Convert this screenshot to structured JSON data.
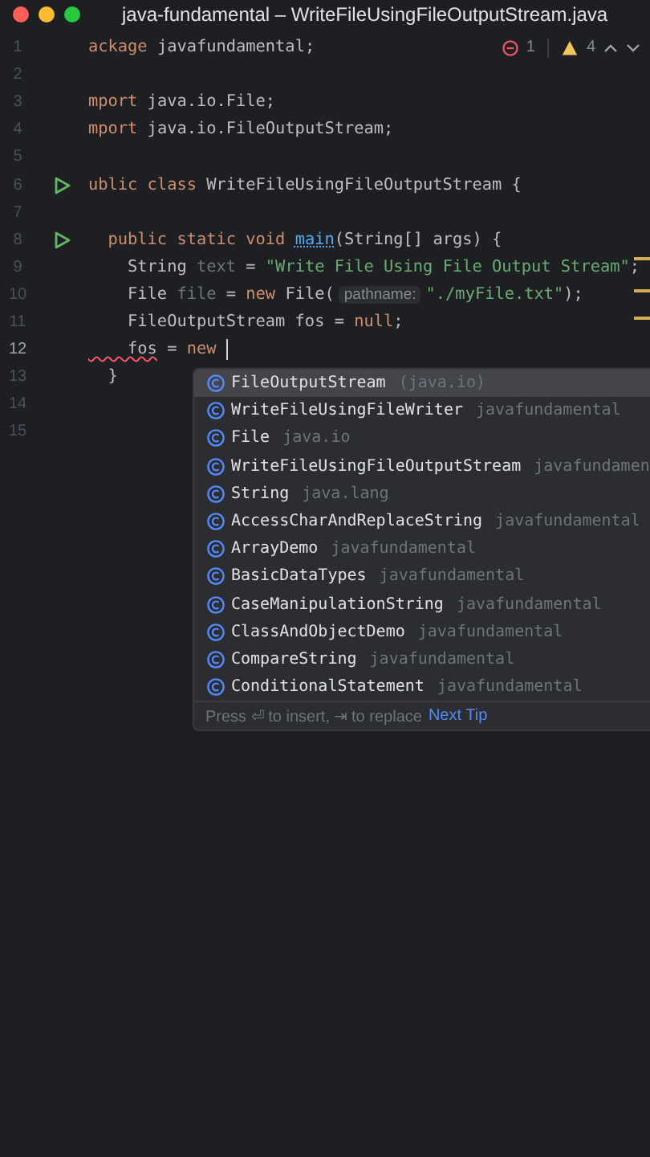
{
  "window": {
    "title": "java-fundamental – WriteFileUsingFileOutputStream.java"
  },
  "inspections": {
    "errors": "1",
    "warnings": "4"
  },
  "lines": [
    {
      "number": "1",
      "run": false,
      "current": false,
      "tokens": [
        {
          "text": "ackage",
          "kind": "keyword"
        },
        {
          "text": " javafundamental;",
          "kind": "plain"
        }
      ]
    },
    {
      "number": "2",
      "run": false,
      "current": false
    },
    {
      "number": "3",
      "run": false,
      "current": false,
      "tokens": [
        {
          "text": "mport",
          "kind": "keyword"
        },
        {
          "text": " java.io.File;",
          "kind": "plain"
        }
      ]
    },
    {
      "number": "4",
      "run": false,
      "current": false,
      "tokens": [
        {
          "text": "mport",
          "kind": "keyword"
        },
        {
          "text": " java.io.FileOutputStream;",
          "kind": "plain"
        }
      ]
    },
    {
      "number": "5",
      "run": false,
      "current": false
    },
    {
      "number": "6",
      "run": true,
      "current": false,
      "tokens": [
        {
          "text": "ublic class",
          "kind": "keyword"
        },
        {
          "text": " WriteFileUsingFileOutputStream {",
          "kind": "plain"
        }
      ]
    },
    {
      "number": "7",
      "run": false,
      "current": false
    },
    {
      "number": "8",
      "run": true,
      "current": false,
      "tokens": [
        {
          "text": "  public static void ",
          "kind": "keyword"
        },
        {
          "text": "main",
          "kind": "method"
        },
        {
          "text": "(String[] args) {",
          "kind": "plain"
        }
      ]
    },
    {
      "number": "9",
      "run": false,
      "current": false,
      "tokens": [
        {
          "text": "    String ",
          "kind": "plain"
        },
        {
          "text": "text",
          "kind": "unused"
        },
        {
          "text": " = ",
          "kind": "plain"
        },
        {
          "text": "\"Write File Using File Output Stream\"",
          "kind": "string"
        },
        {
          "text": ";",
          "kind": "plain"
        }
      ]
    },
    {
      "number": "10",
      "run": false,
      "current": false,
      "tokens": [
        {
          "text": "    File ",
          "kind": "plain"
        },
        {
          "text": "file",
          "kind": "unused"
        },
        {
          "text": " = ",
          "kind": "plain"
        },
        {
          "text": "new",
          "kind": "keyword"
        },
        {
          "text": " File(",
          "kind": "plain"
        },
        {
          "text": "pathname:",
          "kind": "hint"
        },
        {
          "text": "\"./myFile.txt\"",
          "kind": "string"
        },
        {
          "text": ");",
          "kind": "plain"
        }
      ]
    },
    {
      "number": "11",
      "run": false,
      "current": false,
      "tokens": [
        {
          "text": "    FileOutputStream fos = ",
          "kind": "plain"
        },
        {
          "text": "null",
          "kind": "keyword"
        },
        {
          "text": ";",
          "kind": "plain"
        }
      ]
    },
    {
      "number": "12",
      "run": false,
      "current": true,
      "tokens": [
        {
          "text": "    fos",
          "kind": "error"
        },
        {
          "text": " = ",
          "kind": "plain"
        },
        {
          "text": "new ",
          "kind": "keyword"
        }
      ]
    },
    {
      "number": "13",
      "run": false,
      "current": false,
      "tokens": [
        {
          "text": "  }",
          "kind": "plain"
        }
      ]
    },
    {
      "number": "14",
      "run": false,
      "current": false
    },
    {
      "number": "15",
      "run": false,
      "current": false
    }
  ],
  "completion": {
    "items": [
      {
        "name": "FileOutputStream",
        "detail": "(java.io)",
        "selected": true
      },
      {
        "name": "WriteFileUsingFileWriter",
        "detail": "javafundamental",
        "selected": false
      },
      {
        "name": "File",
        "detail": "java.io",
        "selected": false
      },
      {
        "name": "WriteFileUsingFileOutputStream",
        "detail": "javafundamen",
        "selected": false
      },
      {
        "name": "String",
        "detail": "java.lang",
        "selected": false
      },
      {
        "name": "AccessCharAndReplaceString",
        "detail": "javafundamental",
        "selected": false
      },
      {
        "name": "ArrayDemo",
        "detail": "javafundamental",
        "selected": false
      },
      {
        "name": "BasicDataTypes",
        "detail": "javafundamental",
        "selected": false
      },
      {
        "name": "CaseManipulationString",
        "detail": "javafundamental",
        "selected": false
      },
      {
        "name": "ClassAndObjectDemo",
        "detail": "javafundamental",
        "selected": false
      },
      {
        "name": "CompareString",
        "detail": "javafundamental",
        "selected": false
      },
      {
        "name": "ConditionalStatement",
        "detail": "javafundamental",
        "selected": false
      }
    ],
    "hint": "Press ⏎ to insert, ⇥ to replace",
    "tip_link": "Next Tip"
  }
}
